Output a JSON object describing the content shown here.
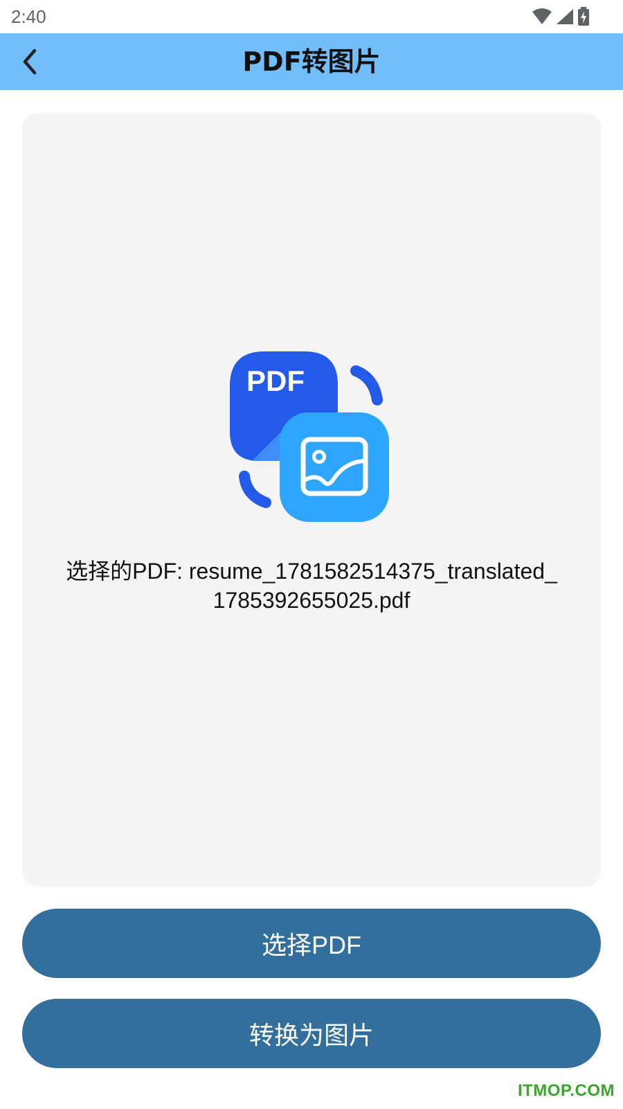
{
  "status_bar": {
    "time": "2:40",
    "icons": [
      "wifi-icon",
      "signal-icon",
      "battery-charging-icon"
    ]
  },
  "app_bar": {
    "title": "PDF转图片",
    "back_icon": "chevron-left-icon",
    "background_color": "#72bdfc"
  },
  "preview": {
    "illustration": {
      "pdf_badge_text": "PDF",
      "image_icon": "image-icon"
    },
    "selected_file_text": "选择的PDF: resume_1781582514375_translated_1785392655025.pdf"
  },
  "actions": {
    "select_pdf_label": "选择PDF",
    "convert_label": "转换为图片",
    "button_color": "#336f9c"
  },
  "watermark": "ITMOP.COM"
}
